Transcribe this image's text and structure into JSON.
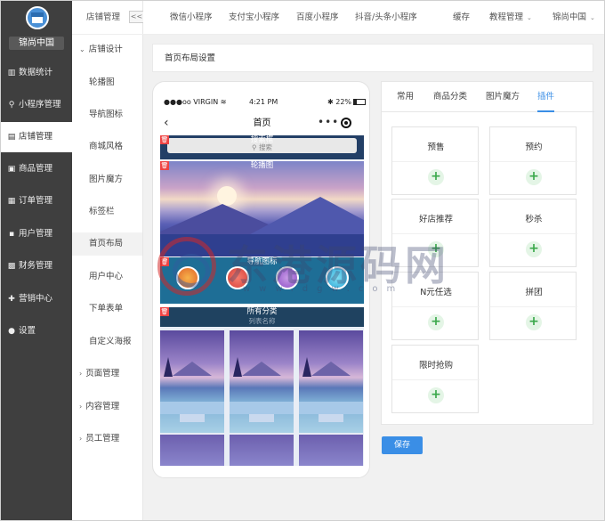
{
  "sidebar": {
    "brand": "锦尚中国",
    "items": [
      {
        "icon": "▥",
        "label": "数据统计"
      },
      {
        "icon": "⚲",
        "label": "小程序管理"
      },
      {
        "icon": "▤",
        "label": "店铺管理"
      },
      {
        "icon": "▣",
        "label": "商品管理"
      },
      {
        "icon": "▦",
        "label": "订单管理"
      },
      {
        "icon": "▪",
        "label": "用户管理"
      },
      {
        "icon": "▩",
        "label": "财务管理"
      },
      {
        "icon": "✚",
        "label": "营销中心"
      },
      {
        "icon": "●",
        "label": "设置"
      }
    ]
  },
  "subnav": {
    "header": "店铺管理",
    "collapse": "<<",
    "group_open": "店铺设计",
    "children": [
      "轮播图",
      "导航图标",
      "商城风格",
      "图片魔方",
      "标签栏",
      "首页布局",
      "用户中心",
      "下单表单",
      "自定义海报"
    ],
    "groups": [
      "页面管理",
      "内容管理",
      "员工管理"
    ]
  },
  "topbar": {
    "links": [
      "微信小程序",
      "支付宝小程序",
      "百度小程序",
      "抖音/头条小程序",
      "缓存"
    ],
    "dropdowns": [
      "教程管理",
      "锦尚中国"
    ]
  },
  "breadcrumb": "首页布局设置",
  "phone": {
    "carrier": "●●●oo VIRGIN",
    "wifi": "≋",
    "time": "4:21 PM",
    "bt": "✱",
    "battery": "22%",
    "back": "‹",
    "title": "首页",
    "menu": "•••",
    "delete_icon": "🗑",
    "search_label": "搜索框",
    "search_placeholder": "搜索",
    "banner_label": "轮播图",
    "nav_label": "导航图标",
    "cat_label": "所有分类",
    "cat_sub": "列表名称"
  },
  "panel": {
    "tabs": [
      "常用",
      "商品分类",
      "图片魔方",
      "插件"
    ],
    "active_tab": 3,
    "plus": "+",
    "cards": [
      "预售",
      "预约",
      "好店推荐",
      "秒杀",
      "N元任选",
      "拼团",
      "限时抢购"
    ]
  },
  "save_label": "保存",
  "watermark": {
    "text": "东港源码网",
    "url": "www.dgw.com"
  }
}
